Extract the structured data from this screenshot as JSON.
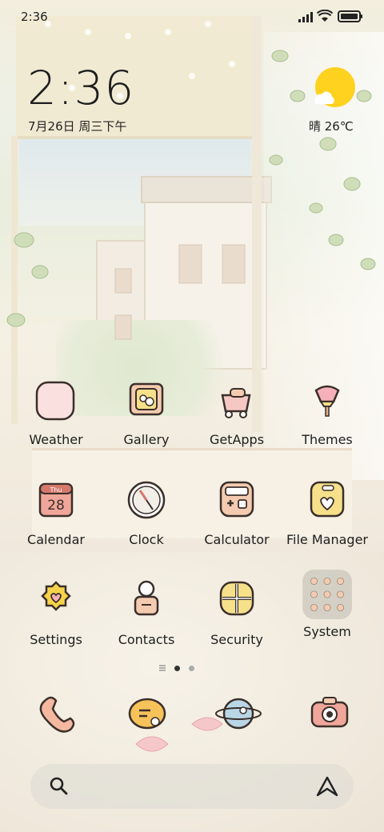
{
  "status_bar": {
    "time": "2:36",
    "signal_icon": "signal-icon",
    "wifi_icon": "wifi-icon",
    "battery_icon": "battery-icon"
  },
  "clock_widget": {
    "time": "2:36",
    "date": "7月26日 周三下午"
  },
  "weather_widget": {
    "temp": "晴 26℃",
    "icon": "sun-icon"
  },
  "apps": [
    {
      "label": "Weather",
      "icon": "weather-icon"
    },
    {
      "label": "Gallery",
      "icon": "gallery-icon"
    },
    {
      "label": "GetApps",
      "icon": "getapps-icon"
    },
    {
      "label": "Themes",
      "icon": "themes-icon"
    },
    {
      "label": "Calendar",
      "icon": "calendar-icon",
      "calendar_day": "Thu",
      "calendar_date": "28"
    },
    {
      "label": "Clock",
      "icon": "clock-icon"
    },
    {
      "label": "Calculator",
      "icon": "calculator-icon"
    },
    {
      "label": "File Manager",
      "icon": "folder-icon"
    },
    {
      "label": "Settings",
      "icon": "settings-icon"
    },
    {
      "label": "Contacts",
      "icon": "contacts-icon"
    },
    {
      "label": "Security",
      "icon": "security-icon"
    },
    {
      "label": "System",
      "icon": "folder-system-icon"
    }
  ],
  "dock": [
    {
      "name": "phone",
      "icon": "phone-icon"
    },
    {
      "name": "messages",
      "icon": "messages-icon"
    },
    {
      "name": "browser",
      "icon": "browser-icon"
    },
    {
      "name": "camera",
      "icon": "camera-icon"
    }
  ],
  "page_indicator": {
    "total_pages": 2,
    "current_page": 1
  },
  "search_bar": {
    "search_icon": "search-icon",
    "assistant_icon": "assistant-icon"
  },
  "colors": {
    "accent_sun": "#ffd21f",
    "icon_pink": "#f6c8c4",
    "icon_yellow": "#f6e08a",
    "icon_peach": "#f4cbb0"
  }
}
